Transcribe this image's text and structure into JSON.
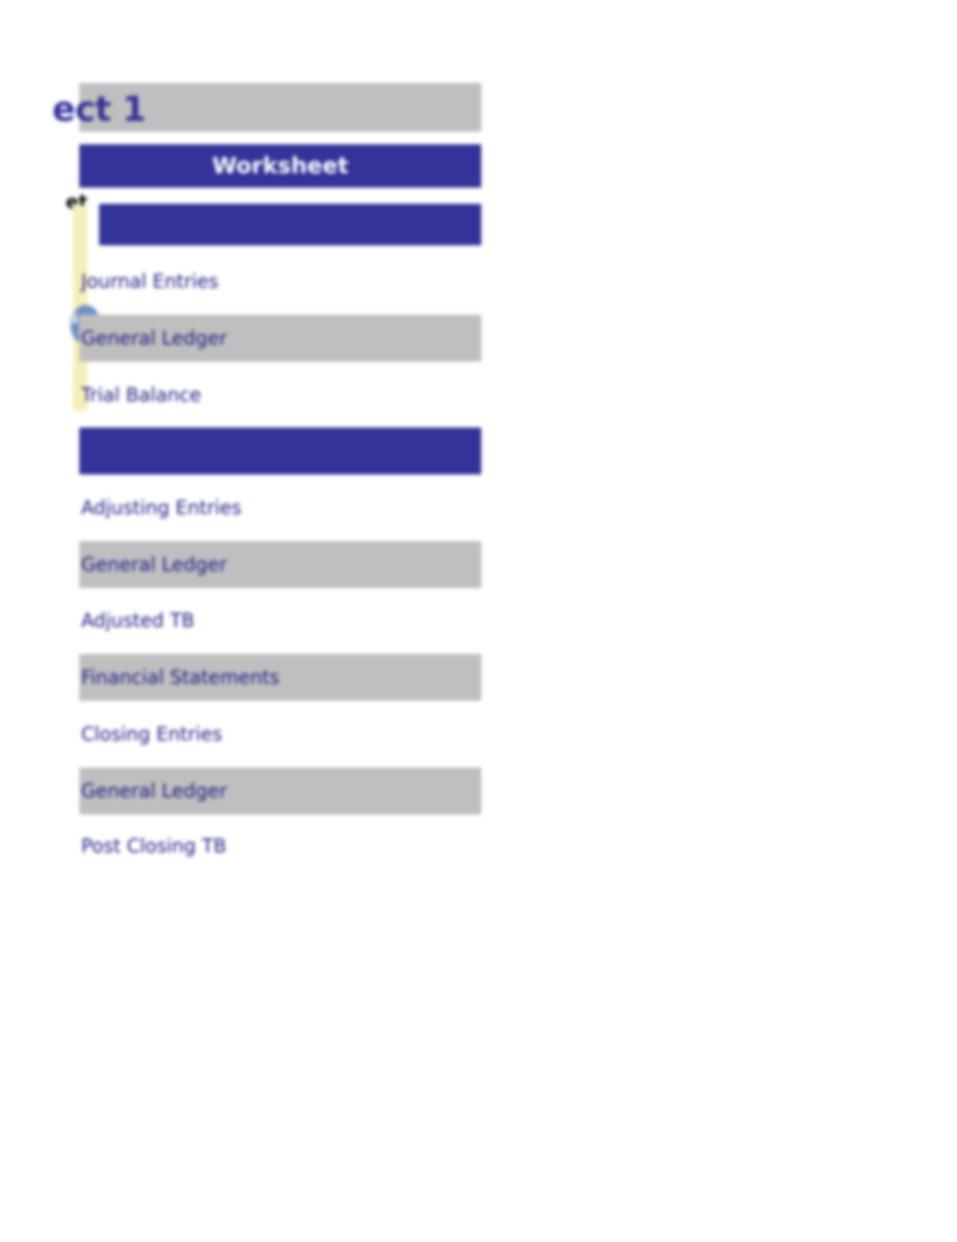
{
  "page": {
    "title": "ect 1",
    "full_title_hint": "ect 1",
    "background_color": "#ffffff",
    "accent_blue": "#333399",
    "shade_gray": "#bfbfbf",
    "link_color": "#1a1a80",
    "highlight_yellow": "#f5f0b8"
  },
  "header": {
    "worksheet_label": "Worksheet",
    "cut_label_left": "et",
    "cut_label_blob": "s"
  },
  "links": [
    {
      "label": "Journal Entries",
      "shaded": false
    },
    {
      "label": "General Ledger",
      "shaded": true
    },
    {
      "label": "Trial Balance",
      "shaded": false
    },
    {
      "label": "Adjusting Entries",
      "shaded": false
    },
    {
      "label": "General Ledger",
      "shaded": true
    },
    {
      "label": "Adjusted TB",
      "shaded": false
    },
    {
      "label": "Financial Statements",
      "shaded": true
    },
    {
      "label": "Closing Entries",
      "shaded": false
    },
    {
      "label": "General Ledger",
      "shaded": true
    },
    {
      "label": "Post Closing TB",
      "shaded": false
    }
  ]
}
